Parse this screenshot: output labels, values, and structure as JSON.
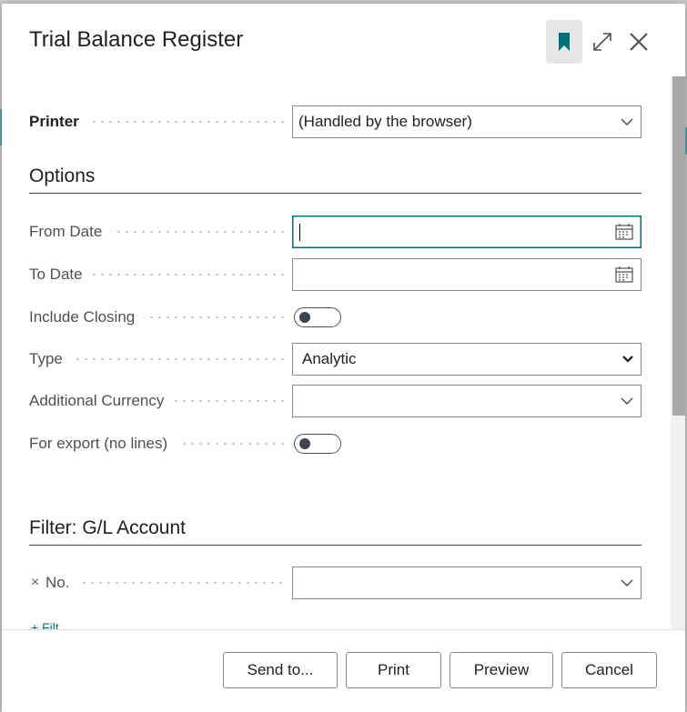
{
  "dialog": {
    "title": "Trial Balance Register",
    "header_icons": [
      "bookmark-icon",
      "expand-icon",
      "close-icon"
    ]
  },
  "printer": {
    "label": "Printer",
    "value": "(Handled by the browser)"
  },
  "options": {
    "title": "Options",
    "from_date": {
      "label": "From Date",
      "value": ""
    },
    "to_date": {
      "label": "To Date",
      "value": ""
    },
    "include_closing": {
      "label": "Include Closing",
      "checked": false
    },
    "type": {
      "label": "Type",
      "value": "Analytic"
    },
    "additional_currency": {
      "label": "Additional Currency",
      "value": ""
    },
    "for_export": {
      "label": "For export (no lines)",
      "checked": false
    }
  },
  "filter": {
    "title": "Filter: G/L Account",
    "clear_symbol": "×",
    "no": {
      "label": "No.",
      "value": ""
    },
    "add_filter_label": "+ Filt..."
  },
  "footer": {
    "send_to": "Send to...",
    "print": "Print",
    "preview": "Preview",
    "cancel": "Cancel"
  },
  "colors": {
    "accent": "#00707a",
    "toggle_knob": "#3d4451"
  }
}
